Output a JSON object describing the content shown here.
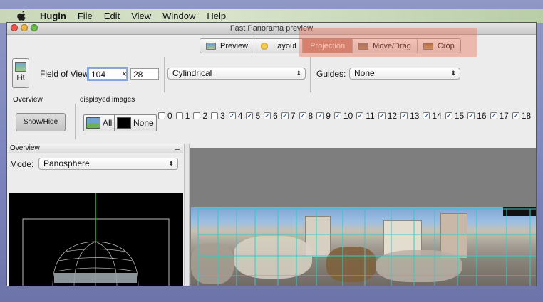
{
  "menubar": {
    "app_name": "Hugin",
    "items": [
      "File",
      "Edit",
      "View",
      "Window",
      "Help"
    ]
  },
  "window": {
    "title": "Fast Panorama preview"
  },
  "toolbar": {
    "tabs": [
      {
        "label": "Preview",
        "icon": "preview-icon",
        "active": false
      },
      {
        "label": "Layout",
        "icon": "layout-icon",
        "active": false
      },
      {
        "label": "Projection",
        "icon": "projection-icon",
        "active": true
      },
      {
        "label": "Move/Drag",
        "icon": "move-drag-icon",
        "active": false
      },
      {
        "label": "Crop",
        "icon": "crop-icon",
        "active": false
      }
    ]
  },
  "fov": {
    "fit_label": "Fit",
    "label": "Field of View",
    "h_value": "104",
    "times": "×",
    "v_value": "28",
    "projection": "Cylindrical",
    "guides_label": "Guides:",
    "guides_value": "None"
  },
  "overview_section": {
    "label": "Overview",
    "showhide_label": "Show/Hide"
  },
  "displayed_images": {
    "label": "displayed images",
    "all_label": "All",
    "none_label": "None",
    "items": [
      {
        "n": "0",
        "checked": false
      },
      {
        "n": "1",
        "checked": false
      },
      {
        "n": "2",
        "checked": false
      },
      {
        "n": "3",
        "checked": false
      },
      {
        "n": "4",
        "checked": true
      },
      {
        "n": "5",
        "checked": true
      },
      {
        "n": "6",
        "checked": true
      },
      {
        "n": "7",
        "checked": true
      },
      {
        "n": "8",
        "checked": true
      },
      {
        "n": "9",
        "checked": true
      },
      {
        "n": "10",
        "checked": true
      },
      {
        "n": "11",
        "checked": true
      },
      {
        "n": "12",
        "checked": true
      },
      {
        "n": "13",
        "checked": true
      },
      {
        "n": "14",
        "checked": true
      },
      {
        "n": "15",
        "checked": true
      },
      {
        "n": "16",
        "checked": true
      },
      {
        "n": "17",
        "checked": true
      },
      {
        "n": "18",
        "checked": true
      }
    ]
  },
  "overview_panel": {
    "title": "Overview",
    "mode_label": "Mode:",
    "mode_value": "Panosphere"
  },
  "colors": {
    "highlight": "#eb6e50",
    "active_tab": "#c88c82",
    "grid": "#38c8c8",
    "axis_green": "#24c424"
  }
}
